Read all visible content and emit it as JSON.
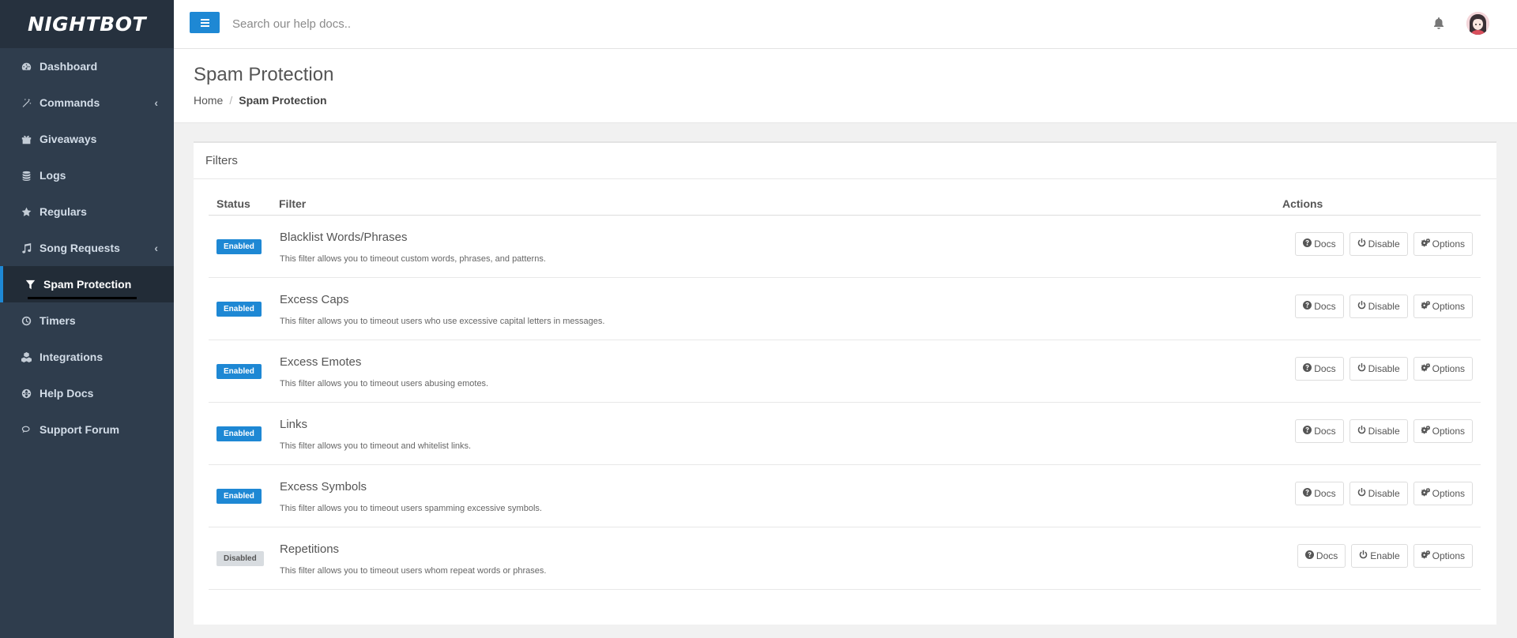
{
  "brand": {
    "logo_text": "NIGHTBOT"
  },
  "topbar": {
    "search_placeholder": "Search our help docs.."
  },
  "sidebar": {
    "items": [
      {
        "label": "Dashboard",
        "icon": "dashboard-icon"
      },
      {
        "label": "Commands",
        "icon": "magic-wand-icon",
        "has_children": true
      },
      {
        "label": "Giveaways",
        "icon": "gift-icon"
      },
      {
        "label": "Logs",
        "icon": "database-icon"
      },
      {
        "label": "Regulars",
        "icon": "star-icon"
      },
      {
        "label": "Song Requests",
        "icon": "music-icon",
        "has_children": true
      },
      {
        "label": "Spam Protection",
        "icon": "filter-icon",
        "active": true
      },
      {
        "label": "Timers",
        "icon": "clock-icon"
      },
      {
        "label": "Integrations",
        "icon": "cubes-icon"
      },
      {
        "label": "Help Docs",
        "icon": "globe-icon"
      },
      {
        "label": "Support Forum",
        "icon": "comments-icon"
      }
    ]
  },
  "page": {
    "title": "Spam Protection",
    "breadcrumb": {
      "home": "Home",
      "current": "Spam Protection"
    }
  },
  "filters_panel": {
    "title": "Filters",
    "columns": {
      "status": "Status",
      "filter": "Filter",
      "actions": "Actions"
    },
    "rows": [
      {
        "status": "Enabled",
        "name": "Blacklist Words/Phrases",
        "description": "This filter allows you to timeout custom words, phrases, and patterns.",
        "docs": "Docs",
        "toggle": "Disable",
        "options": "Options"
      },
      {
        "status": "Enabled",
        "name": "Excess Caps",
        "description": "This filter allows you to timeout users who use excessive capital letters in messages.",
        "docs": "Docs",
        "toggle": "Disable",
        "options": "Options"
      },
      {
        "status": "Enabled",
        "name": "Excess Emotes",
        "description": "This filter allows you to timeout users abusing emotes.",
        "docs": "Docs",
        "toggle": "Disable",
        "options": "Options"
      },
      {
        "status": "Enabled",
        "name": "Links",
        "description": "This filter allows you to timeout and whitelist links.",
        "docs": "Docs",
        "toggle": "Disable",
        "options": "Options"
      },
      {
        "status": "Enabled",
        "name": "Excess Symbols",
        "description": "This filter allows you to timeout users spamming excessive symbols.",
        "docs": "Docs",
        "toggle": "Disable",
        "options": "Options"
      },
      {
        "status": "Disabled",
        "name": "Repetitions",
        "description": "This filter allows you to timeout users whom repeat words or phrases.",
        "docs": "Docs",
        "toggle": "Enable",
        "options": "Options"
      }
    ]
  },
  "colors": {
    "accent": "#1e88d4",
    "sidebar_bg": "#2f3d4d",
    "sidebar_active_bg": "#222c37",
    "disabled_badge": "#d8dce0"
  }
}
